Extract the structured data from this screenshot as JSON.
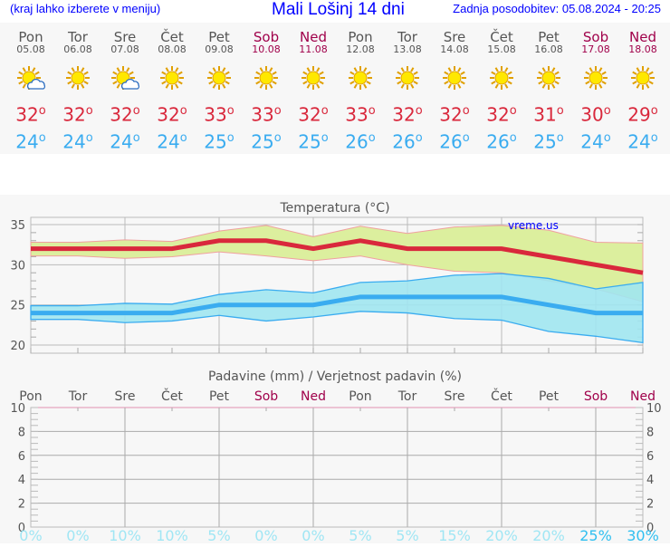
{
  "header": {
    "hint": "(kraj lahko izberete v meniju)",
    "title": "Mali Lošinj 14 dni",
    "updated": "Zadnja posodobitev: 05.08.2024 - 20:25"
  },
  "days": [
    {
      "name": "Pon",
      "date": "05.08",
      "icon": "sun-cloud-icon",
      "max": "32",
      "min": "24",
      "weekend": false
    },
    {
      "name": "Tor",
      "date": "06.08",
      "icon": "sun-icon",
      "max": "32",
      "min": "24",
      "weekend": false
    },
    {
      "name": "Sre",
      "date": "07.08",
      "icon": "sun-cloud-icon",
      "max": "32",
      "min": "24",
      "weekend": false
    },
    {
      "name": "Čet",
      "date": "08.08",
      "icon": "sun-icon",
      "max": "32",
      "min": "24",
      "weekend": false
    },
    {
      "name": "Pet",
      "date": "09.08",
      "icon": "sun-icon",
      "max": "33",
      "min": "25",
      "weekend": false
    },
    {
      "name": "Sob",
      "date": "10.08",
      "icon": "sun-icon",
      "max": "33",
      "min": "25",
      "weekend": true
    },
    {
      "name": "Ned",
      "date": "11.08",
      "icon": "sun-icon",
      "max": "32",
      "min": "25",
      "weekend": true
    },
    {
      "name": "Pon",
      "date": "12.08",
      "icon": "sun-icon",
      "max": "33",
      "min": "26",
      "weekend": false
    },
    {
      "name": "Tor",
      "date": "13.08",
      "icon": "sun-icon",
      "max": "32",
      "min": "26",
      "weekend": false
    },
    {
      "name": "Sre",
      "date": "14.08",
      "icon": "sun-icon",
      "max": "32",
      "min": "26",
      "weekend": false
    },
    {
      "name": "Čet",
      "date": "15.08",
      "icon": "sun-icon",
      "max": "32",
      "min": "26",
      "weekend": false
    },
    {
      "name": "Pet",
      "date": "16.08",
      "icon": "sun-icon",
      "max": "31",
      "min": "25",
      "weekend": false
    },
    {
      "name": "Sob",
      "date": "17.08",
      "icon": "sun-icon",
      "max": "30",
      "min": "24",
      "weekend": true
    },
    {
      "name": "Ned",
      "date": "18.08",
      "icon": "sun-icon",
      "max": "29",
      "min": "24",
      "weekend": true
    }
  ],
  "degree": "o",
  "chart_data": [
    {
      "type": "line",
      "title": "Temperatura (°C)",
      "watermark": "vreme.us",
      "ylim": [
        19,
        36
      ],
      "yticks": [
        20,
        25,
        30,
        35
      ],
      "grid": true,
      "x": [
        "05.08",
        "06.08",
        "07.08",
        "08.08",
        "09.08",
        "10.08",
        "11.08",
        "12.08",
        "13.08",
        "14.08",
        "15.08",
        "16.08",
        "17.08",
        "18.08"
      ],
      "series": [
        {
          "role": "max",
          "color": "#d9283c",
          "values": [
            32,
            32,
            32,
            32,
            33,
            33,
            32,
            33,
            32,
            32,
            32,
            31,
            30,
            29
          ],
          "band_high": [
            32.8,
            32.8,
            33.1,
            32.9,
            34.2,
            34.9,
            33.5,
            34.8,
            33.9,
            34.7,
            34.9,
            34.3,
            32.8,
            32.7
          ],
          "band_low": [
            31.1,
            31.1,
            30.8,
            31.0,
            31.6,
            31.1,
            30.5,
            31.1,
            30.0,
            29.2,
            29.0,
            28.0,
            27.0,
            25.4
          ],
          "band_color": "#dcef9e"
        },
        {
          "role": "min",
          "color": "#3aacf0",
          "values": [
            24,
            24,
            24,
            24,
            25,
            25,
            25,
            26,
            26,
            26,
            26,
            25,
            24,
            24
          ],
          "band_high": [
            24.9,
            24.9,
            25.2,
            25.1,
            26.3,
            26.9,
            26.5,
            27.8,
            28.0,
            28.7,
            28.9,
            28.3,
            27.0,
            27.8
          ],
          "band_low": [
            23.2,
            23.2,
            22.8,
            23.0,
            23.7,
            23.0,
            23.5,
            24.2,
            24.0,
            23.3,
            23.1,
            21.7,
            21.1,
            20.3
          ],
          "band_color": "#a0e6ef"
        }
      ]
    },
    {
      "type": "bar",
      "title": "Padavine (mm) / Verjetnost padavin (%)",
      "ylim": [
        0,
        10
      ],
      "yticks": [
        0,
        2,
        4,
        6,
        8,
        10
      ],
      "grid": true,
      "categories": [
        "Pon",
        "Tor",
        "Sre",
        "Čet",
        "Pet",
        "Sob",
        "Ned",
        "Pon",
        "Tor",
        "Sre",
        "Čet",
        "Pet",
        "Sob",
        "Ned"
      ],
      "values": [
        0,
        0,
        0,
        0,
        0,
        0,
        0,
        0,
        0,
        0,
        0,
        0,
        0,
        0
      ],
      "probability": [
        "0%",
        "0%",
        "10%",
        "10%",
        "5%",
        "0%",
        "0%",
        "5%",
        "5%",
        "15%",
        "20%",
        "20%",
        "25%",
        "30%"
      ]
    }
  ]
}
